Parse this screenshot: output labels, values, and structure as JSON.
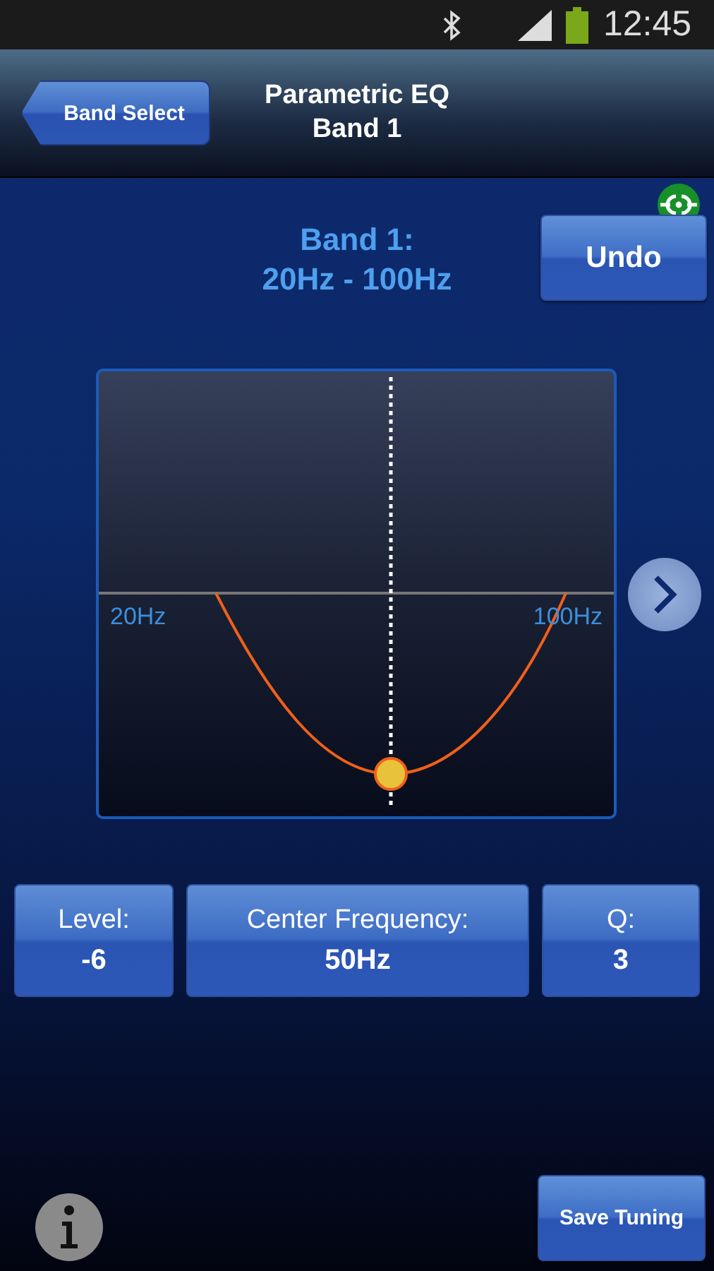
{
  "status_bar": {
    "time": "12:45"
  },
  "header": {
    "back_button": "Band Select",
    "title_line_1": "Parametric EQ",
    "title_line_2": "Band 1"
  },
  "band_info": {
    "title": "Band 1:",
    "range": "20Hz - 100Hz"
  },
  "undo_button": "Undo",
  "graph": {
    "low_label": "20Hz",
    "high_label": "100Hz"
  },
  "params": [
    {
      "label": "Level:",
      "value": "-6"
    },
    {
      "label": "Center Frequency:",
      "value": "50Hz"
    },
    {
      "label": "Q:",
      "value": "3"
    }
  ],
  "save_button": "Save Tuning"
}
